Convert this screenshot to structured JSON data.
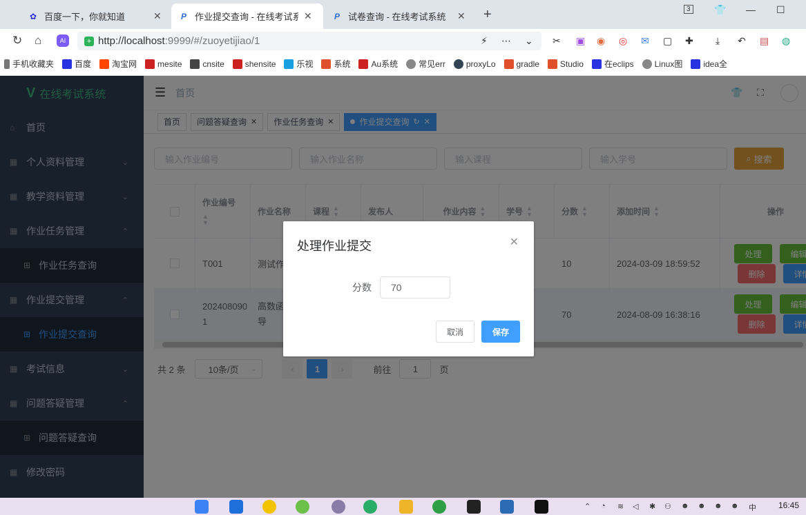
{
  "browser": {
    "tabs": [
      {
        "label": "百度一下，你就知道",
        "active": false
      },
      {
        "label": "作业提交查询 - 在线考试系统",
        "active": true
      },
      {
        "label": "试卷查询 - 在线考试系统",
        "active": false
      }
    ],
    "tab_count": "3",
    "url_host": "http://localhost",
    "url_rest": ":9999/#/zuoyetijiao/1",
    "bookmarks": [
      "手机收藏夹",
      "百度",
      "淘宝网",
      "mesite",
      "cnsite",
      "shensite",
      "乐视",
      "系统",
      "Au系统",
      "常见err",
      "proxyLo",
      "gradle",
      "Studio",
      "在eclips",
      "Linux图",
      "idea全"
    ]
  },
  "app": {
    "logo_text": "在线考试系统",
    "sidebar": [
      {
        "label": "首页",
        "type": "item"
      },
      {
        "label": "个人资料管理",
        "type": "group",
        "open": false
      },
      {
        "label": "教学资料管理",
        "type": "group",
        "open": false
      },
      {
        "label": "作业任务管理",
        "type": "group",
        "open": true
      },
      {
        "label": "作业任务查询",
        "type": "sub"
      },
      {
        "label": "作业提交管理",
        "type": "group",
        "open": true
      },
      {
        "label": "作业提交查询",
        "type": "sub",
        "active": true
      },
      {
        "label": "考试信息",
        "type": "group",
        "open": false
      },
      {
        "label": "问题答疑管理",
        "type": "group",
        "open": true
      },
      {
        "label": "问题答疑查询",
        "type": "sub"
      },
      {
        "label": "修改密码",
        "type": "item"
      }
    ],
    "breadcrumb": "首页",
    "tags": [
      {
        "label": "首页",
        "closable": false
      },
      {
        "label": "问题答疑查询",
        "closable": true
      },
      {
        "label": "作业任务查询",
        "closable": true
      },
      {
        "label": "作业提交查询",
        "closable": true,
        "active": true
      }
    ],
    "filters": {
      "placeholders": [
        "输入作业编号",
        "输入作业名称",
        "输入课程",
        "输入学号"
      ],
      "search_label": "搜索"
    },
    "table": {
      "headers": [
        "作业编号",
        "作业名称",
        "课程",
        "发布人",
        "作业内容",
        "学号",
        "分数",
        "添加时间",
        "操作"
      ],
      "rows": [
        {
          "id": "T001",
          "name": "测试作",
          "score": "10",
          "time": "2024-03-09 18:59:52"
        },
        {
          "id": "2024080901",
          "name": "高数函数求导",
          "score": "70",
          "time": "2024-08-09 16:38:16"
        }
      ],
      "actions": {
        "process": "处理",
        "edit": "编辑",
        "delete": "删除",
        "detail": "详情"
      }
    },
    "pager": {
      "total": "共 2 条",
      "page_size": "10条/页",
      "current": "1",
      "goto": "前往",
      "goto_value": "1",
      "page_suffix": "页"
    }
  },
  "dialog": {
    "title": "处理作业提交",
    "field_label": "分数",
    "field_value": "70",
    "cancel": "取消",
    "save": "保存"
  },
  "taskbar": {
    "time": "16:45"
  },
  "colors": {
    "primary": "#409eff",
    "success": "#67c23a",
    "danger": "#f56c6c",
    "warning": "#e6a23c",
    "sidebar": "#304156"
  }
}
